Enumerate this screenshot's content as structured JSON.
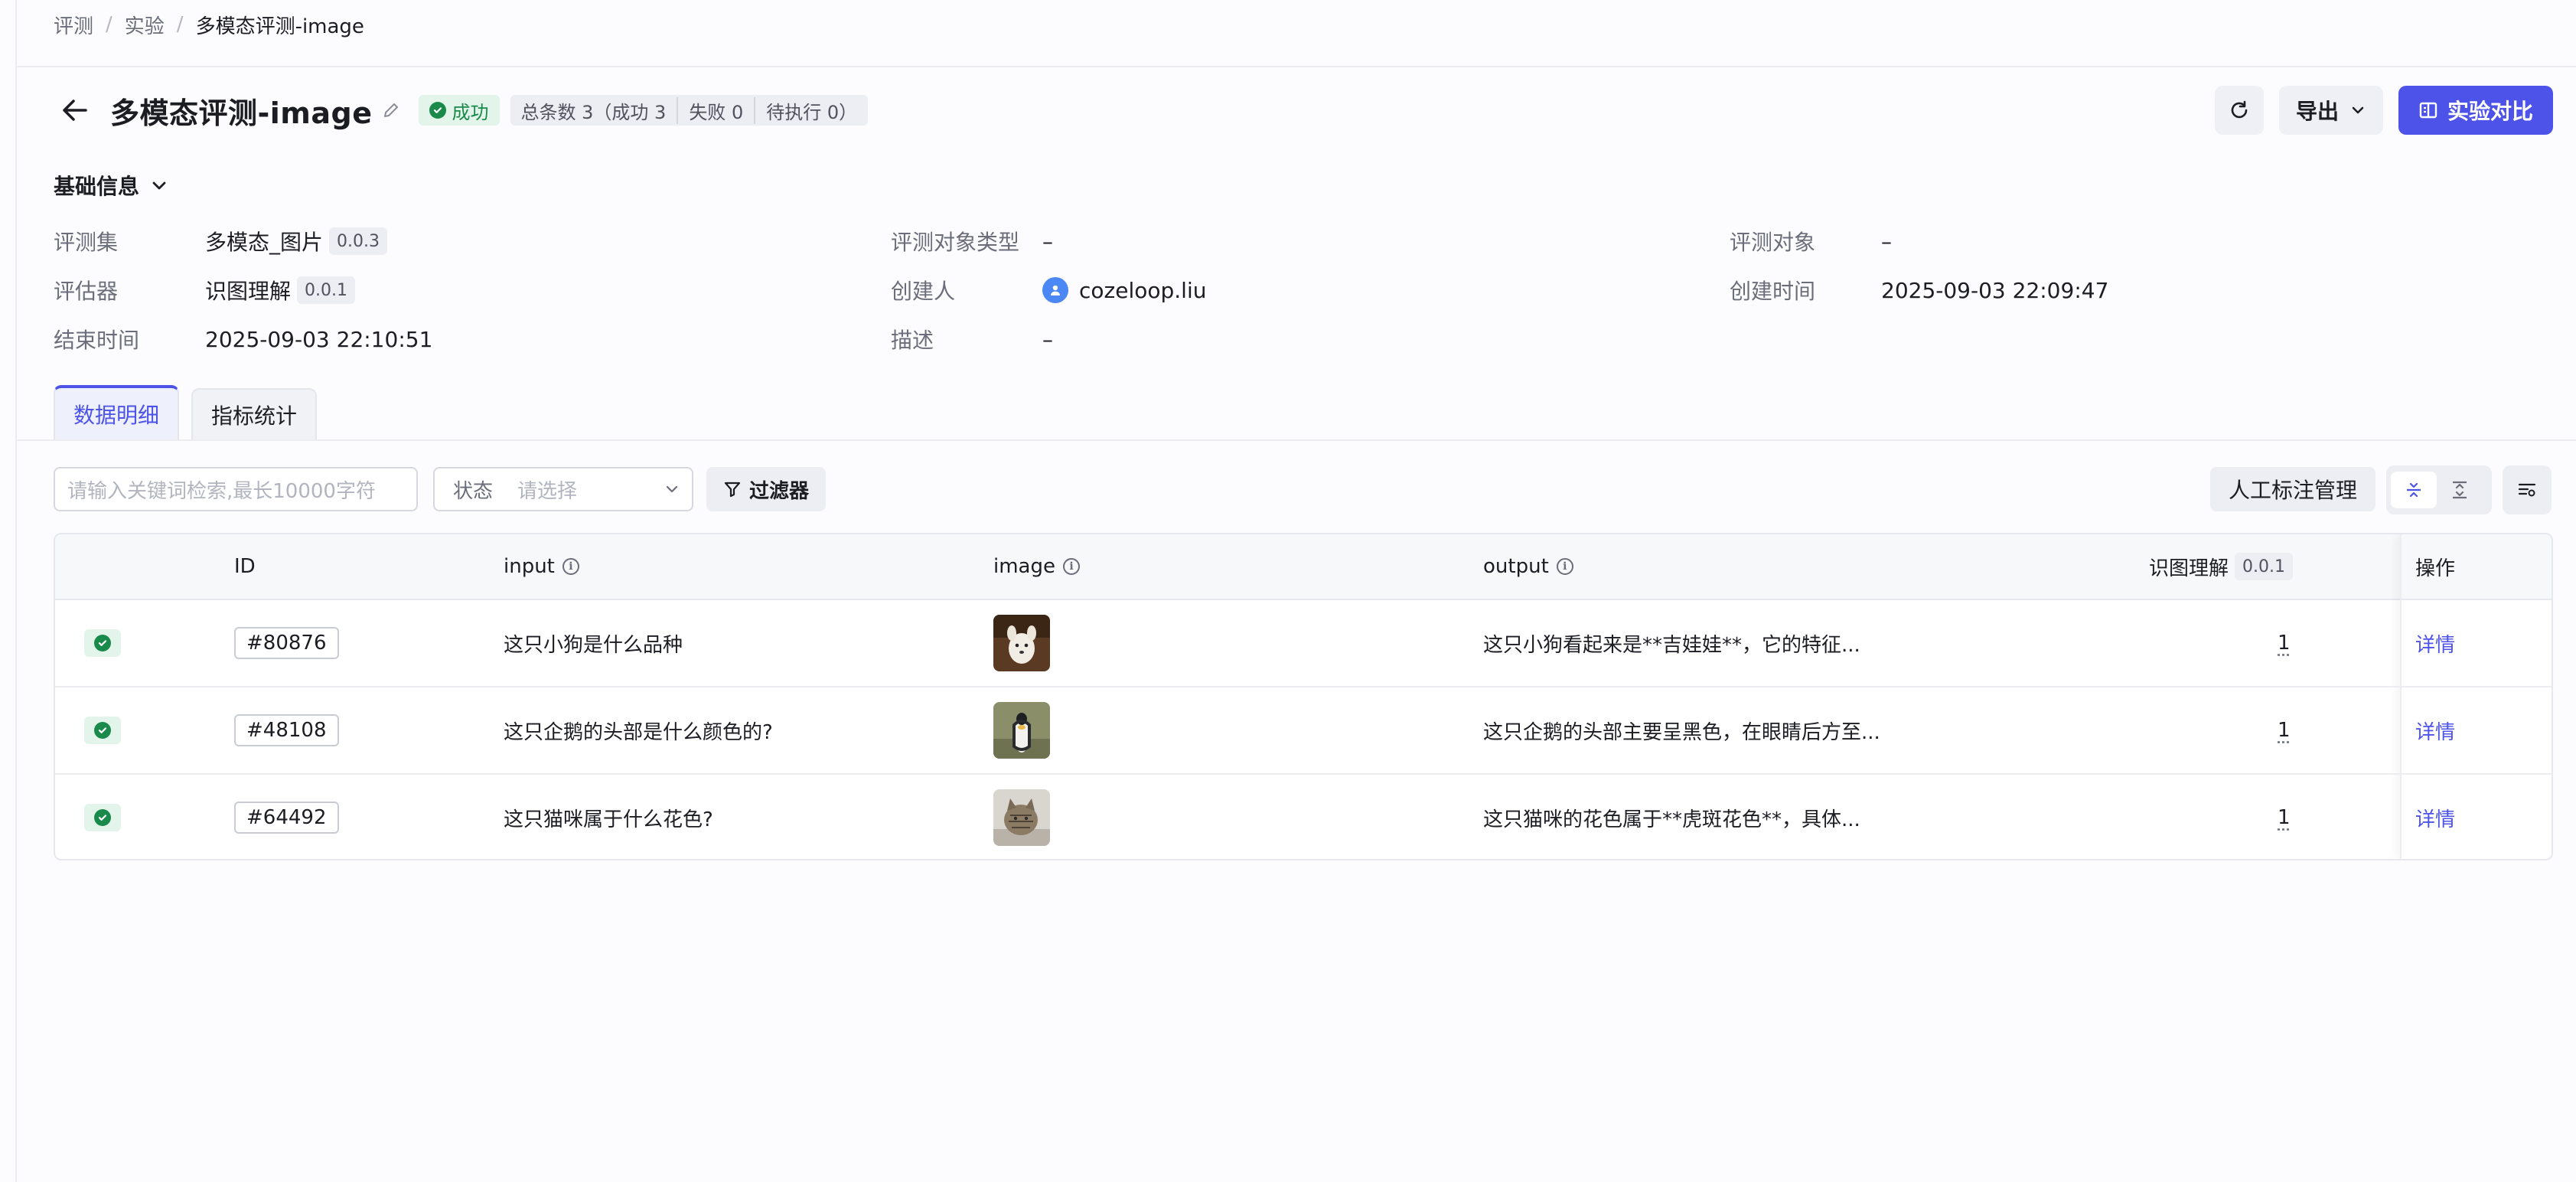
{
  "breadcrumb": [
    "评测",
    "实验",
    "多模态评测-image"
  ],
  "header": {
    "title": "多模态评测-image",
    "status": "成功",
    "counts": [
      "总条数 3（成功 3",
      "失败 0",
      "待执行 0）"
    ],
    "export_label": "导出",
    "compare_label": "实验对比"
  },
  "basic_info": {
    "title": "基础信息",
    "eval_set_label": "评测集",
    "eval_set_value": "多模态_图片",
    "eval_set_version": "0.0.3",
    "target_type_label": "评测对象类型",
    "target_type_value": "–",
    "target_label": "评测对象",
    "target_value": "–",
    "evaluator_label": "评估器",
    "evaluator_value": "识图理解",
    "evaluator_version": "0.0.1",
    "creator_label": "创建人",
    "creator_value": "cozeloop.liu",
    "created_label": "创建时间",
    "created_value": "2025-09-03 22:09:47",
    "ended_label": "结束时间",
    "ended_value": "2025-09-03 22:10:51",
    "desc_label": "描述",
    "desc_value": "–"
  },
  "tabs": [
    "数据明细",
    "指标统计"
  ],
  "toolbar": {
    "search_placeholder": "请输入关键词检索,最长10000字符",
    "status_label": "状态",
    "status_placeholder": "请选择",
    "filter_label": "过滤器",
    "annotation_label": "人工标注管理"
  },
  "table": {
    "columns": {
      "id": "ID",
      "input": "input",
      "image": "image",
      "output": "output",
      "evaluator": "识图理解",
      "evaluator_version": "0.0.1",
      "ops": "操作"
    },
    "rows": [
      {
        "id": "#80876",
        "input": "这只小狗是什么品种",
        "image": "dog",
        "output": "这只小狗看起来是**吉娃娃**，它的特征...",
        "score": "1",
        "op": "详情"
      },
      {
        "id": "#48108",
        "input": "这只企鹅的头部是什么颜色的?",
        "image": "penguin",
        "output": "这只企鹅的头部主要呈黑色，在眼睛后方至...",
        "score": "1",
        "op": "详情"
      },
      {
        "id": "#64492",
        "input": "这只猫咪属于什么花色?",
        "image": "cat",
        "output": "这只猫咪的花色属于**虎斑花色**，具体...",
        "score": "1",
        "op": "详情"
      }
    ]
  },
  "colors": {
    "accent": "#4d53e8",
    "success": "#1a8a4a",
    "success_bg": "#e3f5ea"
  }
}
